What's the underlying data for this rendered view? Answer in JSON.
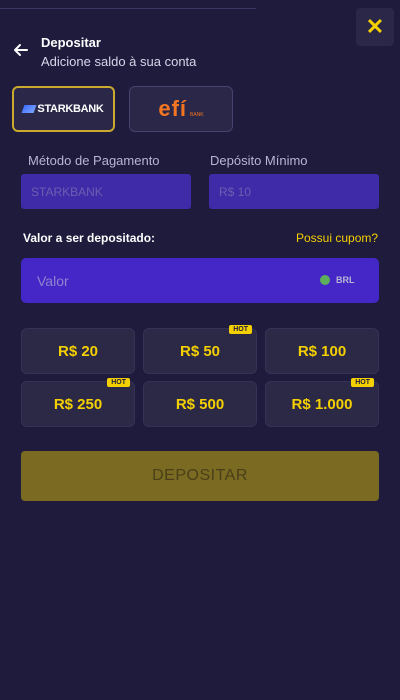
{
  "header": {
    "title": "Depositar",
    "subtitle": "Adicione saldo à sua conta"
  },
  "close_label": "✕",
  "providers": [
    {
      "name": "STARKBANK",
      "selected": true
    },
    {
      "name": "efí",
      "sub": "BANK",
      "selected": false
    }
  ],
  "fields": {
    "method_label": "Método de Pagamento",
    "method_value": "STARKBANK",
    "min_label": "Depósito Mínimo",
    "min_value": "R$ 10"
  },
  "deposit": {
    "label": "Valor a ser depositado:",
    "coupon_link": "Possui cupom?",
    "placeholder": "Valor",
    "currency": "BRL"
  },
  "amounts": [
    {
      "label": "R$ 20",
      "hot": false
    },
    {
      "label": "R$ 50",
      "hot": true
    },
    {
      "label": "R$ 100",
      "hot": false
    },
    {
      "label": "R$ 250",
      "hot": true
    },
    {
      "label": "R$ 500",
      "hot": false
    },
    {
      "label": "R$ 1.000",
      "hot": true
    }
  ],
  "hot_label": "HOT",
  "submit_label": "DEPOSITAR",
  "colors": {
    "background": "#1e1b3c",
    "accent": "#f5d000",
    "input": "#4527c7"
  }
}
